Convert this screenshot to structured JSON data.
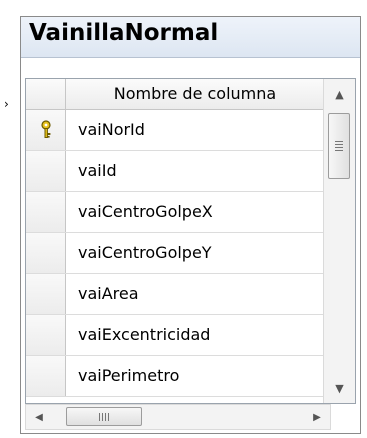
{
  "table": {
    "title": "VainillaNormal",
    "column_header": "Nombre de columna",
    "rows": [
      {
        "name": "vaiNorId",
        "primary_key": true
      },
      {
        "name": "vaiId",
        "primary_key": false
      },
      {
        "name": "vaiCentroGolpeX",
        "primary_key": false
      },
      {
        "name": "vaiCentroGolpeY",
        "primary_key": false
      },
      {
        "name": "vaiArea",
        "primary_key": false
      },
      {
        "name": "vaiExcentricidad",
        "primary_key": false
      },
      {
        "name": "vaiPerimetro",
        "primary_key": false
      }
    ]
  },
  "icons": {
    "primary_key": "key-icon",
    "scroll_up": "arrow-up-icon",
    "scroll_down": "arrow-down-icon",
    "scroll_left": "arrow-left-icon",
    "scroll_right": "arrow-right-icon"
  },
  "scroll": {
    "vertical_position": 0.0,
    "horizontal_position": 0.0
  },
  "colors": {
    "key_icon": "#e8c21a",
    "title_bar": "#e4ebf5"
  }
}
